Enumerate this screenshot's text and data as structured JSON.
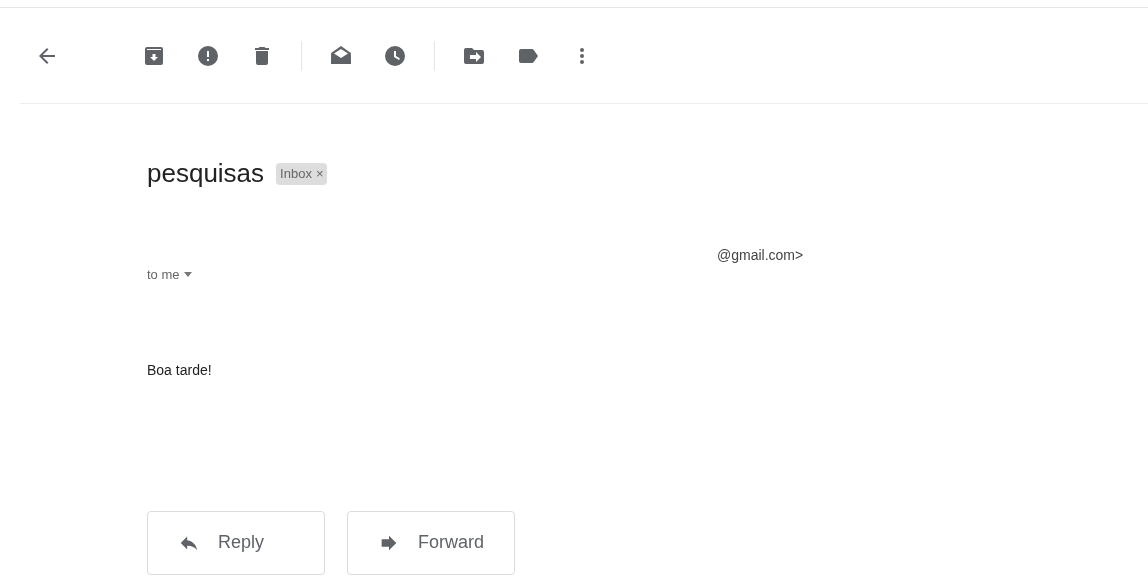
{
  "toolbar": {
    "items": [
      {
        "kind": "back"
      },
      {
        "kind": "archive"
      },
      {
        "kind": "spam"
      },
      {
        "kind": "delete"
      },
      {
        "kind": "divider"
      },
      {
        "kind": "unread"
      },
      {
        "kind": "snooze"
      },
      {
        "kind": "divider"
      },
      {
        "kind": "move"
      },
      {
        "kind": "label"
      },
      {
        "kind": "more"
      }
    ]
  },
  "subject": "pesquisas",
  "label_chip": {
    "text": "Inbox",
    "remove": "×"
  },
  "sender": {
    "email_visible": "@gmail.com>"
  },
  "recipient": "to me",
  "body": "Boa tarde!",
  "actions": [
    {
      "kind": "reply",
      "label": "Reply"
    },
    {
      "kind": "forward",
      "label": "Forward"
    }
  ]
}
